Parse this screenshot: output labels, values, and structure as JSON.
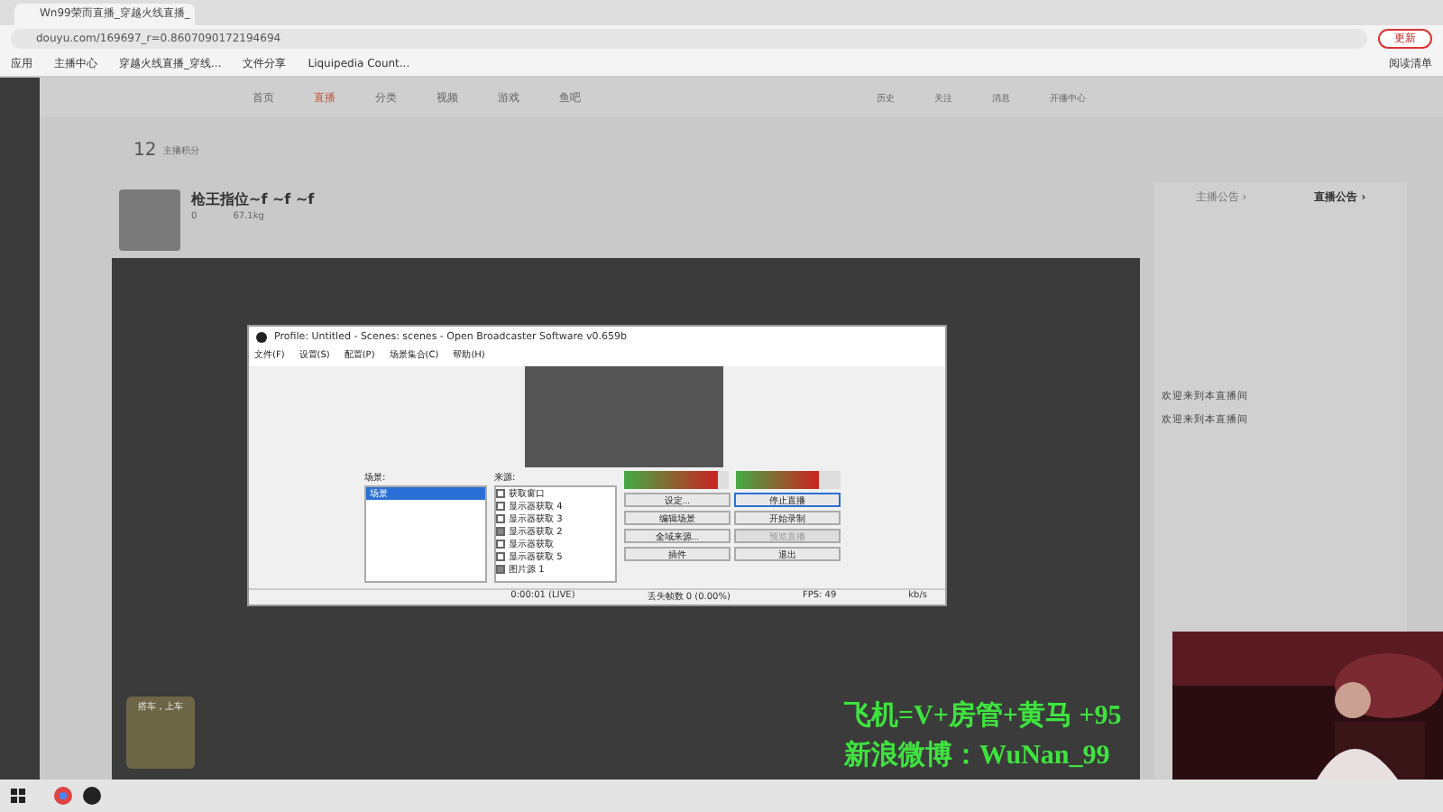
{
  "browser": {
    "tab_title": "Wn99荣而直播_穿越火线直播_",
    "url": "douyu.com/169697_r=0.8607090172194694",
    "update_button": "更新",
    "bookmarks": [
      "应用",
      "主播中心",
      "穿越火线直播_穿线...",
      "文件分享",
      "Liquipedia Count..."
    ],
    "reading_list": "阅读清单"
  },
  "nav": {
    "items": [
      {
        "label": "首页",
        "selected": false
      },
      {
        "label": "直播",
        "selected": true
      },
      {
        "label": "分类",
        "selected": false
      },
      {
        "label": "视频",
        "selected": false
      },
      {
        "label": "游戏",
        "selected": false
      },
      {
        "label": "鱼吧",
        "selected": false
      }
    ],
    "user_items": [
      "历史",
      "关注",
      "消息",
      "开播中心"
    ]
  },
  "toolbar": {
    "score": "12",
    "score_label": "主播积分"
  },
  "room": {
    "title": "枪王指位~f ~f ~f",
    "likes": "0",
    "weight": "67.1kg"
  },
  "side_panel": {
    "tabs": [
      {
        "label": "主播公告 ›",
        "selected": false
      },
      {
        "label": "直播公告 ›",
        "selected": true
      }
    ],
    "chat": [
      {
        "text": "欢迎来到本直播间"
      },
      {
        "text": "欢迎来到本直播间"
      }
    ]
  },
  "promo_card": {
    "title": "搭车，上车"
  },
  "obs": {
    "title": "Profile: Untitled - Scenes: scenes - Open Broadcaster Software v0.659b",
    "menu": [
      "文件(F)",
      "设置(S)",
      "配置(P)",
      "场景集合(C)",
      "帮助(H)"
    ],
    "scenes_label": "场景:",
    "scenes": [
      {
        "label": "场景",
        "selected": true
      }
    ],
    "sources_label": "来源:",
    "sources": [
      {
        "label": "获取窗口",
        "checked": false
      },
      {
        "label": "显示器获取 4",
        "checked": false
      },
      {
        "label": "显示器获取 3",
        "checked": false
      },
      {
        "label": "显示器获取 2",
        "checked": true
      },
      {
        "label": "显示器获取",
        "checked": false
      },
      {
        "label": "显示器获取 5",
        "checked": false
      },
      {
        "label": "图片源 1",
        "checked": true
      }
    ],
    "mic": {
      "level": 0.9
    },
    "speaker": {
      "level": 0.8
    },
    "buttons": [
      {
        "label": "设定...",
        "disabled": false,
        "selected": false
      },
      {
        "label": "停止直播",
        "disabled": false,
        "selected": true
      },
      {
        "label": "编辑场景",
        "disabled": false,
        "selected": false
      },
      {
        "label": "开始录制",
        "disabled": false,
        "selected": false
      },
      {
        "label": "全域来源...",
        "disabled": false,
        "selected": false
      },
      {
        "label": "预览直播",
        "disabled": true,
        "selected": false
      },
      {
        "label": "插件",
        "disabled": false,
        "selected": false
      },
      {
        "label": "退出",
        "disabled": false,
        "selected": false
      }
    ],
    "status": {
      "time": "0:00:01 (LIVE)",
      "dropped": "丢失帧数 0 (0.00%)",
      "fps": "FPS: 49",
      "rate": "kb/s"
    }
  },
  "overlay": {
    "lines": [
      "飞机=V+房管+黄马  +95",
      "新浪微博：WuNan_99"
    ]
  }
}
